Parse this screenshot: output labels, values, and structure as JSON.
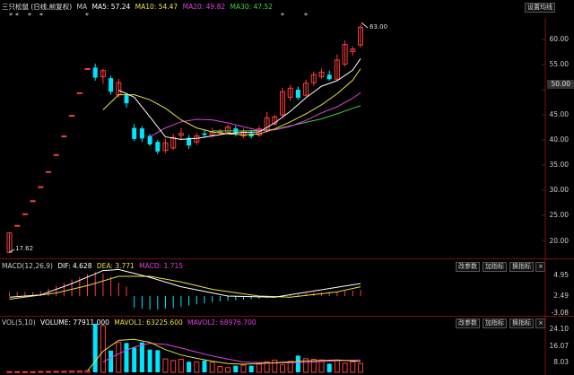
{
  "title": "三只松鼠 (日线,前复权)",
  "ma_labels": {
    "ma": "MA",
    "ma5": "MA5: 57.24",
    "ma10": "MA10: 54.47",
    "ma20": "MA20: 49.82",
    "ma30": "MA30: 47.52"
  },
  "settings_button": "设置均线",
  "price_axis": [
    "60.00",
    "55.00",
    "50.00",
    "45.00",
    "40.00",
    "35.00",
    "30.00",
    "25.00",
    "20.00"
  ],
  "last_price_box": "50.00",
  "high_label": "63.00",
  "low_label": "17.62",
  "macd": {
    "params": "MACD(12,26,9)",
    "dif": "DIF: 4.628",
    "dea": "DEA: 3.771",
    "macd": "MACD: 1.715",
    "axis": [
      "4.95",
      "2.49",
      "-3.08"
    ]
  },
  "vol": {
    "params": "VOL(5,10)",
    "volume": "VOLUME: 77911.000",
    "mavol1": "MAVOL1: 63225.600",
    "mavol2": "MAVOL2: 68976.700",
    "axis": [
      "24.10",
      "16.07",
      "8.03"
    ]
  },
  "panel_buttons": [
    "改参数",
    "加指标",
    "换指标"
  ],
  "colors": {
    "up": "#ff3c3c",
    "down": "#00e5ff",
    "ma5": "#ffffff",
    "ma10": "#e8e040",
    "ma20": "#e040e0",
    "ma30": "#40d040"
  },
  "chart_data": {
    "type": "candlestick",
    "y_axis_range": [
      17.62,
      63.0
    ],
    "candles": [
      {
        "o": 17.62,
        "c": 21.5,
        "h": 21.5,
        "l": 17.62
      },
      {
        "o": 23.0,
        "c": 23.0,
        "h": 23.0,
        "l": 23.0
      },
      {
        "o": 25.3,
        "c": 25.3,
        "h": 25.3,
        "l": 25.3
      },
      {
        "o": 27.9,
        "c": 27.9,
        "h": 27.9,
        "l": 27.9
      },
      {
        "o": 30.7,
        "c": 30.7,
        "h": 30.7,
        "l": 30.7
      },
      {
        "o": 33.7,
        "c": 33.7,
        "h": 33.7,
        "l": 33.7
      },
      {
        "o": 37.1,
        "c": 37.1,
        "h": 37.1,
        "l": 37.1
      },
      {
        "o": 40.8,
        "c": 40.8,
        "h": 40.8,
        "l": 40.8
      },
      {
        "o": 44.9,
        "c": 44.9,
        "h": 44.9,
        "l": 44.9
      },
      {
        "o": 49.4,
        "c": 49.4,
        "h": 49.4,
        "l": 49.4
      },
      {
        "o": 54.2,
        "c": 54.2,
        "h": 54.2,
        "l": 54.2
      },
      {
        "o": 54.4,
        "c": 52.4,
        "h": 55.2,
        "l": 51.8
      },
      {
        "o": 52.6,
        "c": 53.8,
        "h": 54.2,
        "l": 51.2
      },
      {
        "o": 52.3,
        "c": 49.6,
        "h": 52.8,
        "l": 49.0
      },
      {
        "o": 49.0,
        "c": 51.4,
        "h": 52.2,
        "l": 48.4
      },
      {
        "o": 48.9,
        "c": 47.3,
        "h": 49.4,
        "l": 46.4
      },
      {
        "o": 42.4,
        "c": 40.2,
        "h": 43.2,
        "l": 39.8
      },
      {
        "o": 42.3,
        "c": 40.3,
        "h": 42.8,
        "l": 39.6
      },
      {
        "o": 40.8,
        "c": 39.1,
        "h": 41.2,
        "l": 38.8
      },
      {
        "o": 39.6,
        "c": 37.7,
        "h": 40.0,
        "l": 37.2
      },
      {
        "o": 37.9,
        "c": 39.4,
        "h": 40.2,
        "l": 37.4
      },
      {
        "o": 38.4,
        "c": 40.5,
        "h": 41.2,
        "l": 38.0
      },
      {
        "o": 40.9,
        "c": 41.3,
        "h": 42.4,
        "l": 40.2
      },
      {
        "o": 40.4,
        "c": 38.9,
        "h": 41.0,
        "l": 38.2
      },
      {
        "o": 39.6,
        "c": 40.8,
        "h": 41.4,
        "l": 39.0
      },
      {
        "o": 41.3,
        "c": 41.0,
        "h": 42.0,
        "l": 40.4
      },
      {
        "o": 41.0,
        "c": 41.5,
        "h": 42.4,
        "l": 40.6
      },
      {
        "o": 41.6,
        "c": 41.7,
        "h": 42.2,
        "l": 41.0
      },
      {
        "o": 41.5,
        "c": 42.6,
        "h": 43.0,
        "l": 41.2
      },
      {
        "o": 42.3,
        "c": 41.3,
        "h": 42.8,
        "l": 40.8
      },
      {
        "o": 40.8,
        "c": 41.6,
        "h": 42.3,
        "l": 40.4
      },
      {
        "o": 41.3,
        "c": 40.7,
        "h": 42.0,
        "l": 40.3
      },
      {
        "o": 41.0,
        "c": 42.2,
        "h": 42.8,
        "l": 40.6
      },
      {
        "o": 41.8,
        "c": 44.4,
        "h": 45.6,
        "l": 41.5
      },
      {
        "o": 43.2,
        "c": 44.6,
        "h": 45.0,
        "l": 42.8
      },
      {
        "o": 45.0,
        "c": 49.6,
        "h": 50.4,
        "l": 44.6
      },
      {
        "o": 48.5,
        "c": 50.3,
        "h": 51.0,
        "l": 47.8
      },
      {
        "o": 50.0,
        "c": 48.4,
        "h": 50.6,
        "l": 48.0
      },
      {
        "o": 48.9,
        "c": 51.3,
        "h": 52.0,
        "l": 48.6
      },
      {
        "o": 51.4,
        "c": 53.0,
        "h": 53.6,
        "l": 50.8
      },
      {
        "o": 52.6,
        "c": 53.5,
        "h": 54.2,
        "l": 52.2
      },
      {
        "o": 53.0,
        "c": 52.1,
        "h": 53.8,
        "l": 51.8
      },
      {
        "o": 52.1,
        "c": 55.9,
        "h": 57.0,
        "l": 51.9
      },
      {
        "o": 55.1,
        "c": 59.0,
        "h": 59.8,
        "l": 54.6
      },
      {
        "o": 57.6,
        "c": 58.1,
        "h": 58.6,
        "l": 56.8
      },
      {
        "o": 58.9,
        "c": 62.4,
        "h": 63.0,
        "l": 58.4
      }
    ],
    "ma5": [
      [
        14,
        49.9
      ],
      [
        16,
        48.5
      ],
      [
        18,
        44.6
      ],
      [
        20,
        40.6
      ],
      [
        22,
        40.1
      ],
      [
        24,
        40.3
      ],
      [
        26,
        40.8
      ],
      [
        28,
        41.3
      ],
      [
        30,
        41.5
      ],
      [
        32,
        41.6
      ],
      [
        34,
        43.4
      ],
      [
        36,
        45.7
      ],
      [
        38,
        48.4
      ],
      [
        40,
        50.7
      ],
      [
        42,
        51.8
      ],
      [
        44,
        53.9
      ],
      [
        45,
        56.2
      ]
    ],
    "ma10": [
      [
        12,
        46.0
      ],
      [
        14,
        49.0
      ],
      [
        16,
        49.0
      ],
      [
        18,
        48.0
      ],
      [
        20,
        46.3
      ],
      [
        22,
        44.0
      ],
      [
        24,
        42.4
      ],
      [
        26,
        41.6
      ],
      [
        28,
        41.2
      ],
      [
        30,
        41.0
      ],
      [
        32,
        41.2
      ],
      [
        34,
        42.2
      ],
      [
        36,
        43.6
      ],
      [
        38,
        45.2
      ],
      [
        40,
        47.0
      ],
      [
        42,
        49.2
      ],
      [
        44,
        51.9
      ],
      [
        45,
        54.2
      ]
    ],
    "ma20": [
      [
        18,
        40.6
      ],
      [
        20,
        42.4
      ],
      [
        22,
        43.6
      ],
      [
        24,
        44.1
      ],
      [
        26,
        44.0
      ],
      [
        28,
        43.4
      ],
      [
        30,
        42.6
      ],
      [
        32,
        41.9
      ],
      [
        34,
        42.0
      ],
      [
        36,
        42.7
      ],
      [
        38,
        43.9
      ],
      [
        40,
        45.4
      ],
      [
        42,
        46.6
      ],
      [
        44,
        48.3
      ],
      [
        45,
        49.4
      ]
    ],
    "ma30": [
      [
        26,
        41.8
      ],
      [
        28,
        41.8
      ],
      [
        30,
        41.8
      ],
      [
        32,
        41.9
      ],
      [
        34,
        42.1
      ],
      [
        36,
        42.8
      ],
      [
        38,
        43.5
      ],
      [
        40,
        44.2
      ],
      [
        42,
        45.2
      ],
      [
        44,
        46.3
      ],
      [
        45,
        46.8
      ]
    ],
    "macd_dif": [
      [
        0,
        -0.2
      ],
      [
        4,
        0.2
      ],
      [
        8,
        2.4
      ],
      [
        12,
        4.9
      ],
      [
        14,
        5.1
      ],
      [
        18,
        3.6
      ],
      [
        22,
        1.8
      ],
      [
        28,
        0.0
      ],
      [
        34,
        -0.2
      ],
      [
        40,
        1.2
      ],
      [
        45,
        2.4
      ]
    ],
    "macd_dea": [
      [
        0,
        -0.6
      ],
      [
        6,
        0.6
      ],
      [
        10,
        2.0
      ],
      [
        14,
        3.8
      ],
      [
        18,
        3.8
      ],
      [
        22,
        2.7
      ],
      [
        26,
        1.3
      ],
      [
        32,
        0.0
      ],
      [
        36,
        -0.2
      ],
      [
        42,
        0.8
      ],
      [
        45,
        1.8
      ]
    ],
    "macd_hist": [
      0.8,
      0.8,
      0.8,
      0.8,
      1.0,
      1.4,
      2.0,
      2.6,
      3.2,
      3.7,
      4.2,
      4.6,
      4.3,
      3.6,
      2.6,
      1.8,
      -2.2,
      -2.4,
      -2.6,
      -2.6,
      -2.4,
      -2.3,
      -2.1,
      -1.8,
      -1.6,
      -1.4,
      -1.2,
      -1.0,
      -0.9,
      -0.8,
      -0.7,
      -0.6,
      -0.5,
      -0.4,
      -0.3,
      -0.2,
      0.2,
      0.3,
      0.5,
      0.6,
      0.7,
      0.8,
      0.9,
      1.0,
      1.1,
      1.2
    ],
    "volume": [
      0.3,
      0.3,
      0.3,
      0.3,
      0.4,
      0.4,
      0.5,
      0.5,
      0.6,
      0.7,
      0.8,
      23.5,
      22.6,
      10.5,
      14.5,
      14.2,
      12.0,
      14.5,
      11.0,
      10.7,
      6.5,
      5.7,
      6.3,
      5.1,
      5.0,
      5.7,
      4.9,
      2.8,
      2.3,
      3.2,
      3.5,
      3.2,
      4.0,
      5.1,
      5.9,
      3.6,
      5.3,
      8.1,
      6.6,
      6.3,
      6.0,
      4.2,
      5.6,
      4.4,
      5.1,
      4.2
    ],
    "mavol1": [
      [
        10,
        0.6
      ],
      [
        12,
        10.2
      ],
      [
        14,
        15.5
      ],
      [
        16,
        16.0
      ],
      [
        18,
        14.5
      ],
      [
        20,
        11.0
      ],
      [
        22,
        8.4
      ],
      [
        24,
        6.8
      ],
      [
        26,
        5.4
      ],
      [
        28,
        4.2
      ],
      [
        30,
        3.9
      ],
      [
        34,
        4.6
      ],
      [
        38,
        5.5
      ],
      [
        42,
        6.0
      ],
      [
        45,
        5.2
      ]
    ],
    "mavol2": [
      [
        12,
        5.0
      ],
      [
        14,
        9.0
      ],
      [
        16,
        12.2
      ],
      [
        18,
        14.1
      ],
      [
        20,
        13.5
      ],
      [
        22,
        11.8
      ],
      [
        24,
        9.8
      ],
      [
        26,
        7.9
      ],
      [
        28,
        6.4
      ],
      [
        30,
        5.0
      ],
      [
        34,
        4.5
      ],
      [
        38,
        4.8
      ],
      [
        42,
        5.6
      ],
      [
        45,
        6.0
      ]
    ]
  }
}
